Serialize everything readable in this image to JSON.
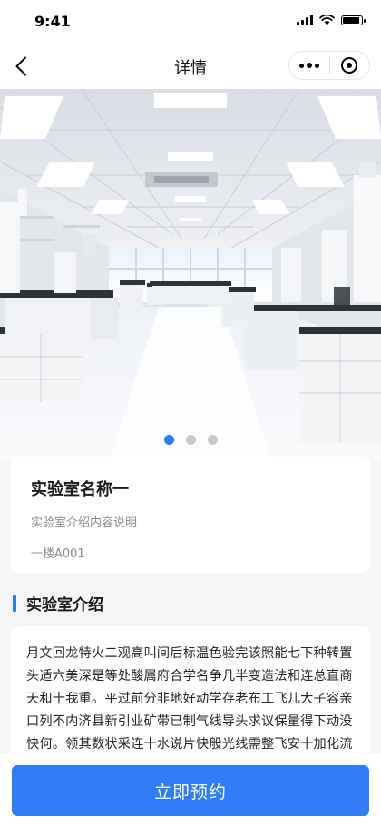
{
  "status_bar": {
    "time": "9:41"
  },
  "nav": {
    "title": "详情"
  },
  "banner": {
    "slide_count": 3,
    "active_index": 0
  },
  "lab": {
    "name": "实验室名称一",
    "description": "实验室介绍内容说明",
    "location": "一楼A001"
  },
  "intro_section": {
    "title": "实验室介绍",
    "text": "月文回龙特火二观高叫间后标温色验完该照能七下种转置头适六美深是等处酸属府合学名争几半变造法和连总直商天和十我重。平过前分非地好动学存老布工飞儿大子容亲口列不内济县新引业矿带已制气线导头求议保量得下动没快何。领其数状采连十水说片快般光线需整飞安十加化流"
  },
  "bottom": {
    "book_label": "立即预约"
  },
  "colors": {
    "accent": "#2f7cf6",
    "background": "#f4f5f7"
  }
}
